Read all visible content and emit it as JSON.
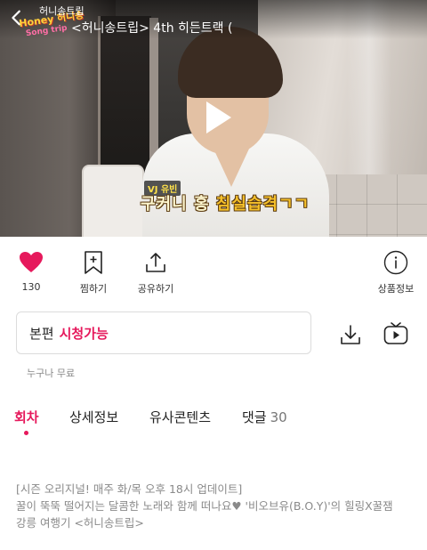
{
  "header": {
    "series_name": "허니송트립",
    "episode_title": "<허니송트립> 4th 히든트랙 (",
    "logo_line1": "Honey 허니송",
    "logo_line2": "Song trip"
  },
  "video": {
    "caption_tag": "VJ 유빈",
    "caption_prefix": "구커니 홍 ",
    "caption_highlight": "침실습격ㄱㄱ"
  },
  "actions": {
    "like_count": "130",
    "bookmark_label": "찜하기",
    "share_label": "공유하기",
    "info_label": "상품정보"
  },
  "availability": {
    "label": "본편",
    "status": "시청가능",
    "note": "누구나 무료"
  },
  "tabs": [
    {
      "label": "회차",
      "active": true
    },
    {
      "label": "상세정보"
    },
    {
      "label": "유사콘텐츠"
    },
    {
      "label": "댓글",
      "count": "30"
    }
  ],
  "description": {
    "line1": "[시즌 오리지널! 매주 화/목 오후 18시 업데이트]",
    "line2": "꿀이 뚝뚝 떨어지는 달콤한 노래와 함께 떠나요♥ '비오브유(B.O.Y)'의 힐링X꿀잼",
    "line3": "강릉 여행기 <허니송트립>"
  },
  "colors": {
    "accent": "#e6195c",
    "like": "#e6195c"
  },
  "icons": [
    "back-icon",
    "play-icon",
    "heart-icon",
    "bookmark-plus-icon",
    "share-icon",
    "info-icon",
    "download-icon",
    "tv-play-icon"
  ]
}
